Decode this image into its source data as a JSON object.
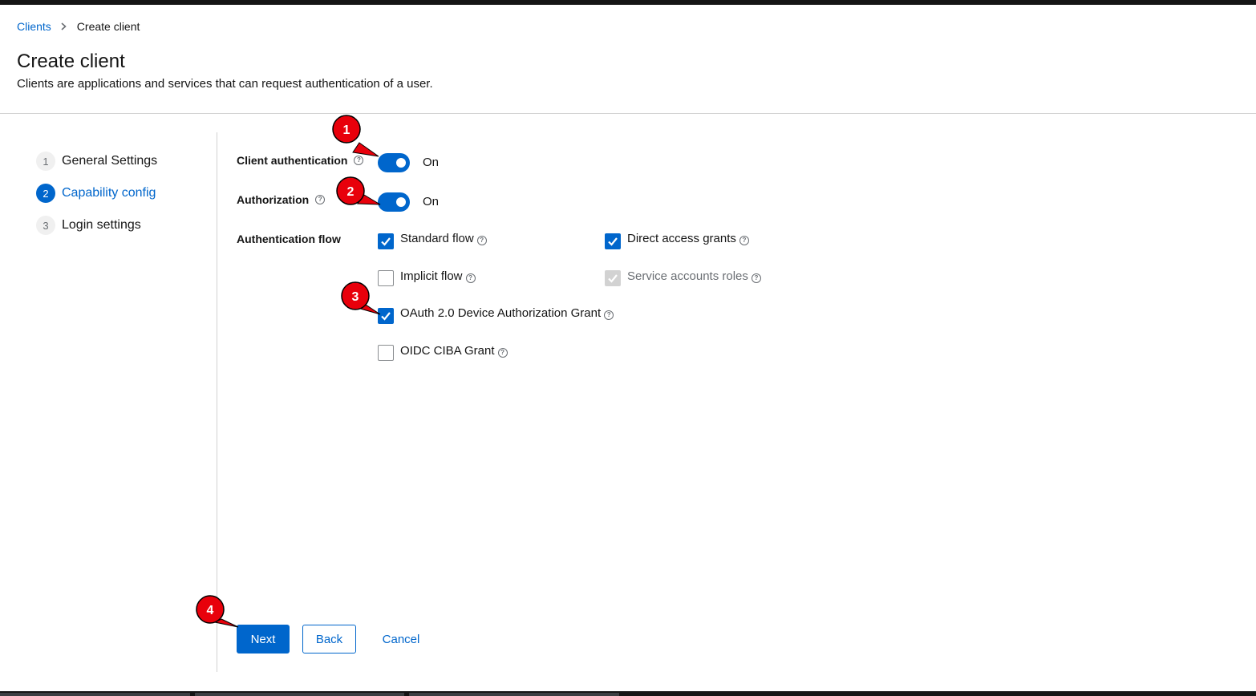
{
  "breadcrumb": {
    "parent": "Clients",
    "current": "Create client"
  },
  "page": {
    "title": "Create client",
    "description": "Clients are applications and services that can request authentication of a user."
  },
  "wizard_steps": [
    {
      "number": "1",
      "label": "General Settings",
      "active": false
    },
    {
      "number": "2",
      "label": "Capability config",
      "active": true
    },
    {
      "number": "3",
      "label": "Login settings",
      "active": false
    }
  ],
  "form": {
    "client_authentication": {
      "label": "Client authentication",
      "state": "On",
      "enabled": true
    },
    "authorization": {
      "label": "Authorization",
      "state": "On",
      "enabled": true
    },
    "authentication_flow": {
      "label": "Authentication flow",
      "options": [
        {
          "label": "Standard flow",
          "checked": true,
          "disabled": false
        },
        {
          "label": "Direct access grants",
          "checked": true,
          "disabled": false
        },
        {
          "label": "Implicit flow",
          "checked": false,
          "disabled": false
        },
        {
          "label": "Service accounts roles",
          "checked": true,
          "disabled": true
        },
        {
          "label": "OAuth 2.0 Device Authorization Grant",
          "checked": true,
          "disabled": false
        },
        {
          "label": "OIDC CIBA Grant",
          "checked": false,
          "disabled": false
        }
      ]
    },
    "help_glyph": "?"
  },
  "actions": {
    "next": "Next",
    "back": "Back",
    "cancel": "Cancel"
  },
  "annotations": [
    "1",
    "2",
    "3",
    "4"
  ],
  "colors": {
    "primary": "#0066cc",
    "annotation_fill": "#e8000b",
    "annotation_stroke": "#000000",
    "text": "#151515",
    "divider": "#d2d2d2"
  }
}
